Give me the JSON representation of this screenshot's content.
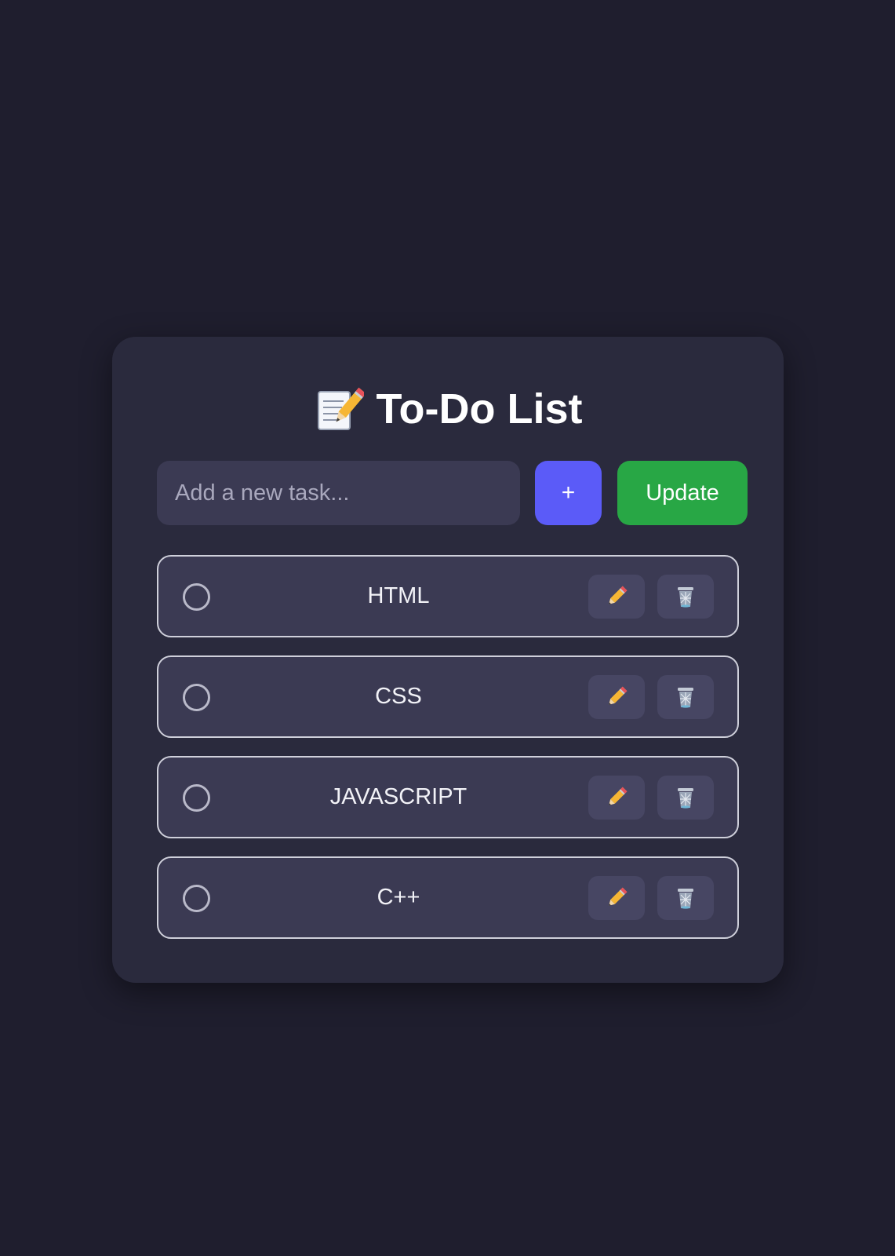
{
  "header": {
    "title": "To-Do List",
    "icon": "memo-pencil-icon"
  },
  "input": {
    "placeholder": "Add a new task...",
    "value": ""
  },
  "buttons": {
    "add_label": "+",
    "update_label": "Update"
  },
  "colors": {
    "background": "#1f1e2e",
    "card": "#2a2a3d",
    "field": "#3b3a53",
    "add_accent": "#5b5bf8",
    "update_accent": "#28a745"
  },
  "tasks": [
    {
      "label": "HTML",
      "done": false
    },
    {
      "label": "CSS",
      "done": false
    },
    {
      "label": "JAVASCRIPT",
      "done": false
    },
    {
      "label": "C++",
      "done": false
    }
  ],
  "task_actions": {
    "edit_icon": "pencil-icon",
    "delete_icon": "trash-icon"
  }
}
